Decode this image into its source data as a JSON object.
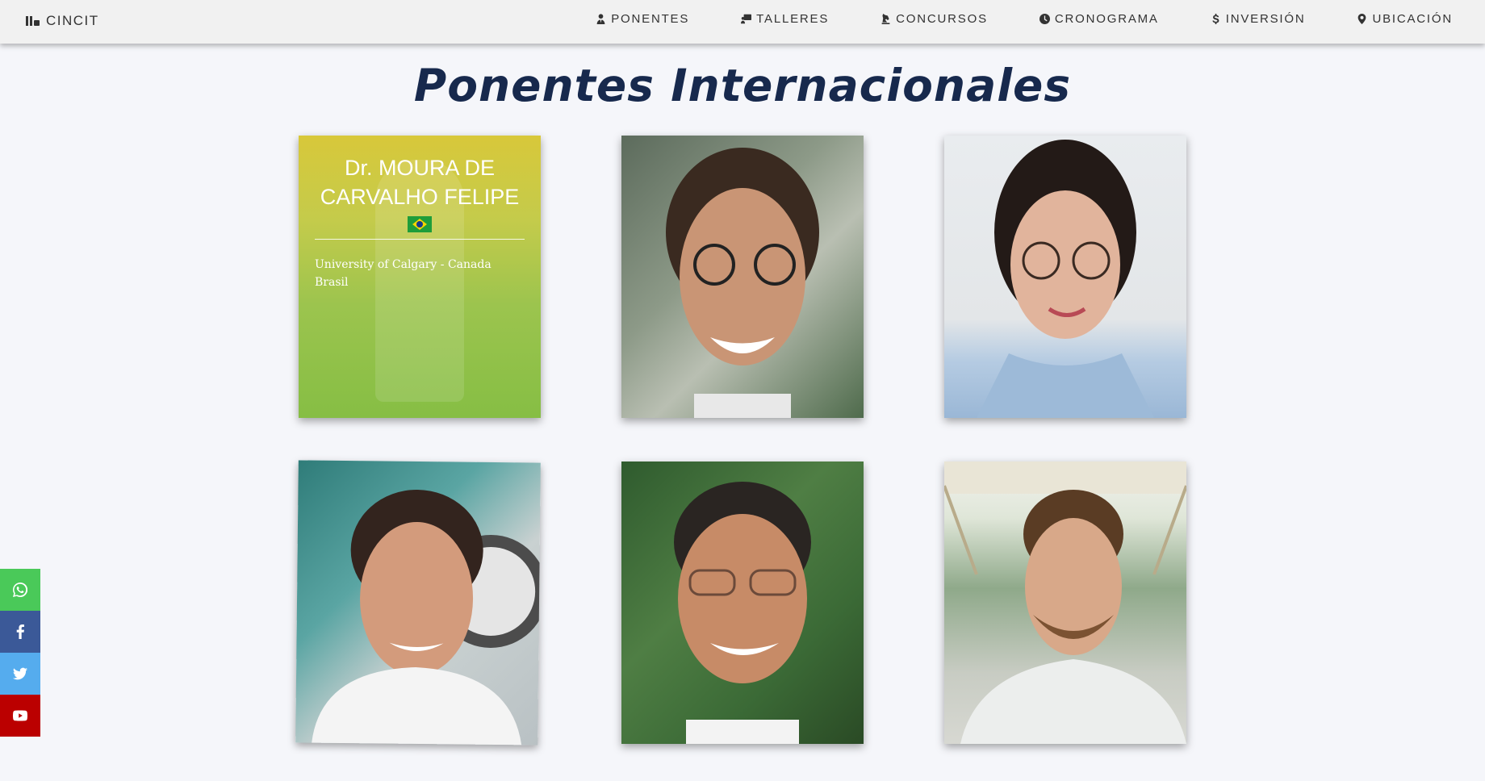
{
  "brand": {
    "label": "CINCIT",
    "icon": "books-icon"
  },
  "nav": {
    "items": [
      {
        "label": "PONENTES",
        "icon": "user-tie-icon"
      },
      {
        "label": "TALLERES",
        "icon": "chalkboard-teacher-icon"
      },
      {
        "label": "CONCURSOS",
        "icon": "chess-knight-icon"
      },
      {
        "label": "CRONOGRAMA",
        "icon": "clock-icon"
      },
      {
        "label": "INVERSIÓN",
        "icon": "dollar-icon"
      },
      {
        "label": "UBICACIÓN",
        "icon": "map-marker-icon"
      }
    ]
  },
  "page_title": "Ponentes Internacionales",
  "speakers": [
    {
      "name": "Dr. MOURA DE CARVALHO FELIPE",
      "flag": "brazil-flag-icon",
      "affiliation_line1": "University of Calgary - Canada",
      "affiliation_line2": "Brasil"
    }
  ],
  "social": [
    {
      "name": "whatsapp",
      "color": "#4ac959"
    },
    {
      "name": "facebook",
      "color": "#3b5998"
    },
    {
      "name": "twitter",
      "color": "#55acee"
    },
    {
      "name": "youtube",
      "color": "#bb0000"
    }
  ]
}
